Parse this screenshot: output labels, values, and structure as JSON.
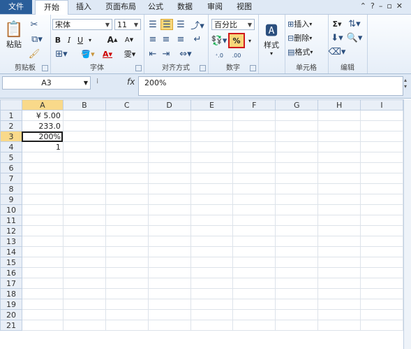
{
  "tabs": [
    "文件",
    "开始",
    "插入",
    "页面布局",
    "公式",
    "数据",
    "审阅",
    "视图"
  ],
  "ribbon": {
    "clipboard": {
      "label": "剪贴板",
      "paste": "粘贴"
    },
    "font": {
      "label": "字体",
      "name": "宋体",
      "size": "11",
      "bold": "B",
      "italic": "I",
      "underline": "U"
    },
    "alignment": {
      "label": "对齐方式"
    },
    "number": {
      "label": "数字",
      "format": "百分比",
      "percent": "%"
    },
    "styles": {
      "label": "样式"
    },
    "cells": {
      "label": "单元格",
      "insert": "插入",
      "delete": "删除",
      "format": "格式"
    },
    "editing": {
      "label": "编辑"
    }
  },
  "formula_bar": {
    "name_box": "A3",
    "fx": "fx",
    "content": "200%"
  },
  "columns": [
    "A",
    "B",
    "C",
    "D",
    "E",
    "F",
    "G",
    "H",
    "I"
  ],
  "rows": [
    "1",
    "2",
    "3",
    "4",
    "5",
    "6",
    "7",
    "8",
    "9",
    "10",
    "11",
    "12",
    "13",
    "14",
    "15",
    "16",
    "17",
    "18",
    "19",
    "20",
    "21"
  ],
  "cells": {
    "A1": "¥ 5.00",
    "A2": "233.0",
    "A3": "200%",
    "A4": "1"
  }
}
